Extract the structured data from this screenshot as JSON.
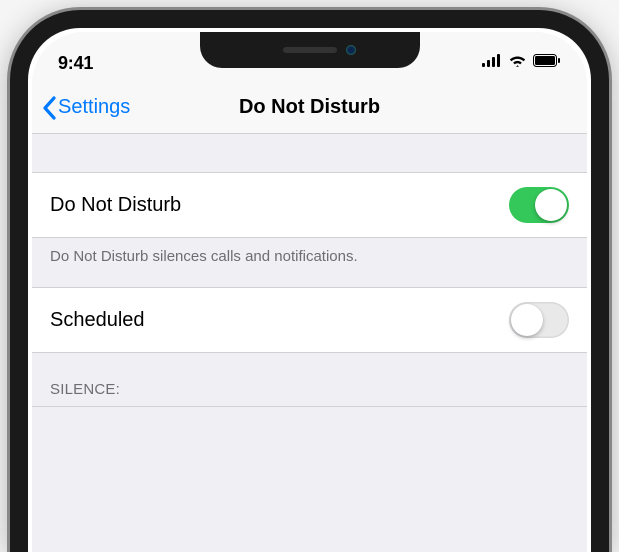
{
  "status": {
    "time": "9:41"
  },
  "nav": {
    "back_label": "Settings",
    "title": "Do Not Disturb"
  },
  "dnd": {
    "label": "Do Not Disturb",
    "enabled": true,
    "footer": "Do Not Disturb silences calls and notifications."
  },
  "scheduled": {
    "label": "Scheduled",
    "enabled": false
  },
  "silence": {
    "header": "SILENCE:"
  },
  "colors": {
    "ios_blue": "#007aff",
    "ios_green": "#34c759",
    "group_bg": "#efeff4",
    "secondary_text": "#6d6d72"
  }
}
